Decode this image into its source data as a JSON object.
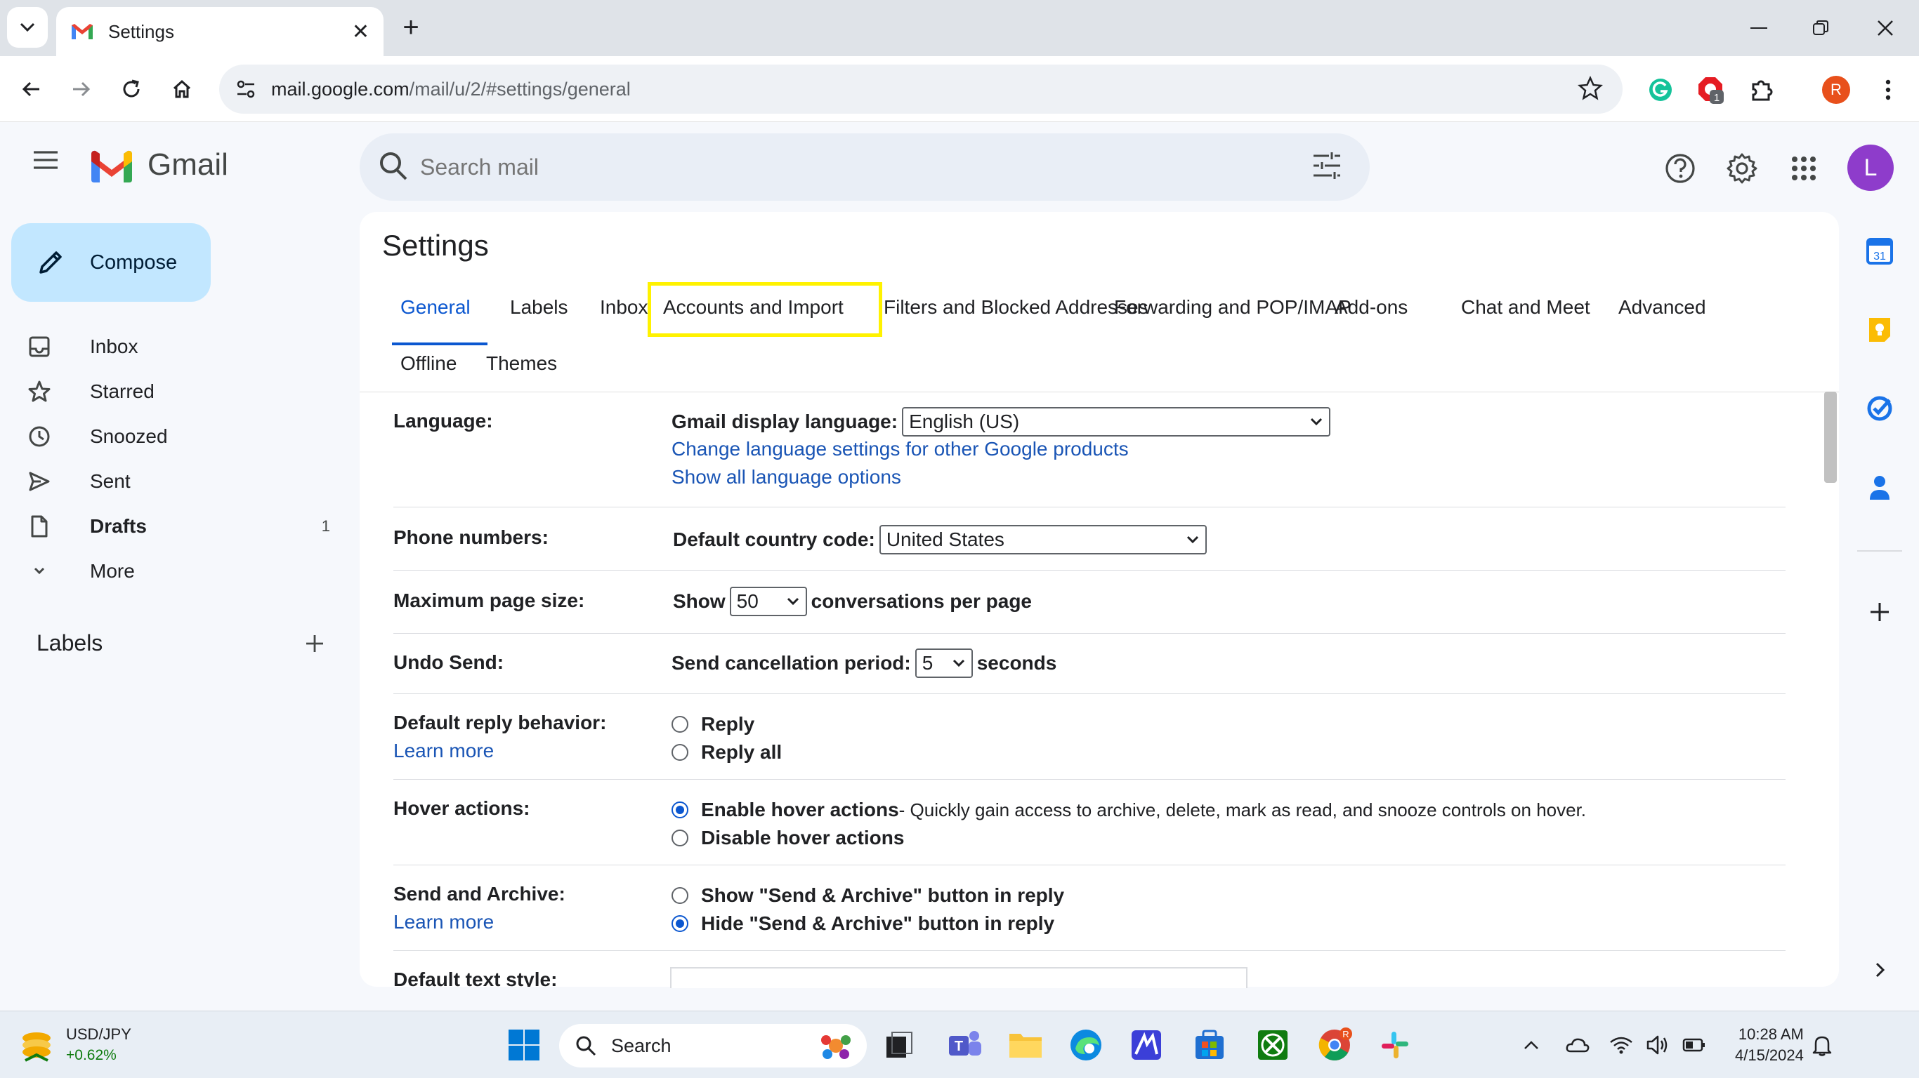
{
  "browser": {
    "tab_title": "Settings",
    "url_host": "mail.google.com",
    "url_path": "/mail/u/2/#settings/general",
    "profile_initial": "R",
    "extension_badge": "1"
  },
  "gmail": {
    "brand": "Gmail",
    "search_placeholder": "Search mail",
    "avatar_initial": "L",
    "compose_label": "Compose",
    "nav": [
      {
        "label": "Inbox",
        "count": ""
      },
      {
        "label": "Starred",
        "count": ""
      },
      {
        "label": "Snoozed",
        "count": ""
      },
      {
        "label": "Sent",
        "count": ""
      },
      {
        "label": "Drafts",
        "count": "1"
      },
      {
        "label": "More",
        "count": ""
      }
    ],
    "labels_title": "Labels"
  },
  "settings": {
    "title": "Settings",
    "tabs": [
      "General",
      "Labels",
      "Inbox",
      "Accounts and Import",
      "Filters and Blocked Addresses",
      "Forwarding and POP/IMAP",
      "Add-ons",
      "Chat and Meet",
      "Advanced",
      "Offline",
      "Themes"
    ],
    "language": {
      "label": "Language:",
      "display_label": "Gmail display language:",
      "display_value": "English (US)",
      "link1": "Change language settings for other Google products",
      "link2": "Show all language options"
    },
    "phone": {
      "label": "Phone numbers:",
      "country_label": "Default country code:",
      "country_value": "United States"
    },
    "page_size": {
      "label": "Maximum page size:",
      "prefix": "Show",
      "value": "50",
      "suffix": "conversations per page"
    },
    "undo": {
      "label": "Undo Send:",
      "prefix": "Send cancellation period:",
      "value": "5",
      "suffix": "seconds"
    },
    "reply": {
      "label": "Default reply behavior:",
      "learn_more": "Learn more",
      "opt1": "Reply",
      "opt2": "Reply all"
    },
    "hover": {
      "label": "Hover actions:",
      "opt1": "Enable hover actions",
      "opt1_desc": " - Quickly gain access to archive, delete, mark as read, and snooze controls on hover.",
      "opt2": "Disable hover actions"
    },
    "send_archive": {
      "label": "Send and Archive:",
      "learn_more": "Learn more",
      "opt1": "Show \"Send & Archive\" button in reply",
      "opt2": "Hide \"Send & Archive\" button in reply"
    },
    "text_style": {
      "label": "Default text style:"
    }
  },
  "taskbar": {
    "ticker_name": "USD/JPY",
    "ticker_change": "+0.62%",
    "search_label": "Search",
    "time": "10:28 AM",
    "date": "4/15/2024"
  },
  "colors": {
    "accent": "#0b57d0",
    "compose_bg": "#c2e7ff",
    "highlight": "#fff200",
    "link": "#1a55b5"
  }
}
